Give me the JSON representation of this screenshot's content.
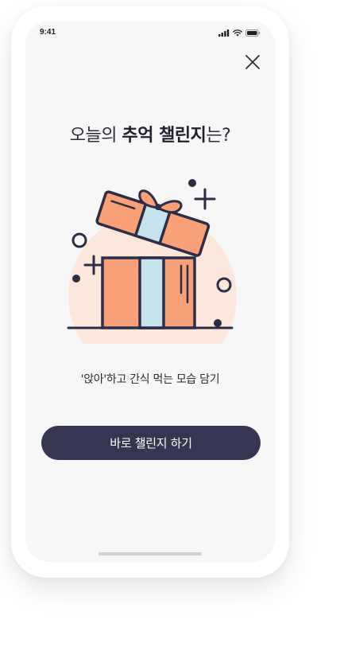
{
  "status_bar": {
    "time": "9:41",
    "icons": [
      "signal-icon",
      "wifi-icon",
      "battery-icon"
    ]
  },
  "header": {
    "close_icon": "close-icon"
  },
  "headline": {
    "prefix": "오늘의 ",
    "emphasis": "추억 챌린지",
    "suffix": "는?"
  },
  "illustration": {
    "icon": "gift-box-open-icon",
    "colors": {
      "orange": "#f9a078",
      "light_blue": "#c4e3ef",
      "peach_circle": "#fde7dc",
      "outline": "#2d2d45"
    }
  },
  "challenge": {
    "description": "'앉아'하고 간식 먹는 모습 담기"
  },
  "actions": {
    "start_label": "바로 챌린지 하기"
  },
  "colors": {
    "button_bg": "#363652",
    "screen_bg": "#f7f7f7"
  }
}
